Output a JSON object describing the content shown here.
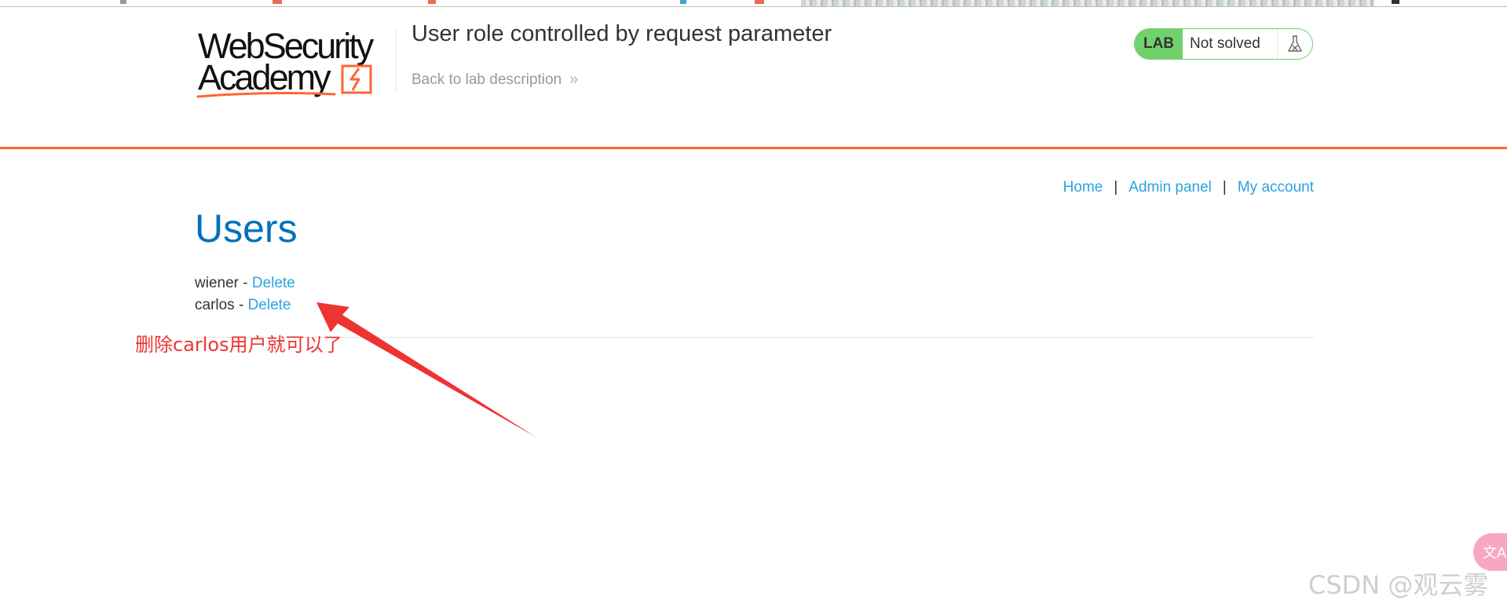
{
  "header": {
    "logo_line1": "WebSecurity",
    "logo_line2": "Academy",
    "lab_title": "User role controlled by request parameter",
    "back_link": "Back to lab description",
    "back_chevron": "»"
  },
  "lab_status": {
    "badge": "LAB",
    "state": "Not solved",
    "icon": "flask-icon",
    "colors": {
      "badge_bg": "#70d16d",
      "accent": "#ff6633"
    }
  },
  "nav": {
    "items": [
      "Home",
      "Admin panel",
      "My account"
    ],
    "separator": "|"
  },
  "main": {
    "title": "Users",
    "users": [
      {
        "name": "wiener",
        "dash": "-",
        "action": "Delete"
      },
      {
        "name": "carlos",
        "dash": "-",
        "action": "Delete"
      }
    ]
  },
  "annotation": {
    "text": "删除carlos用户就可以了",
    "color": "#ee3333"
  },
  "overlay": {
    "watermark": "CSDN @观云雾",
    "translate_icon": "translate-icon"
  }
}
